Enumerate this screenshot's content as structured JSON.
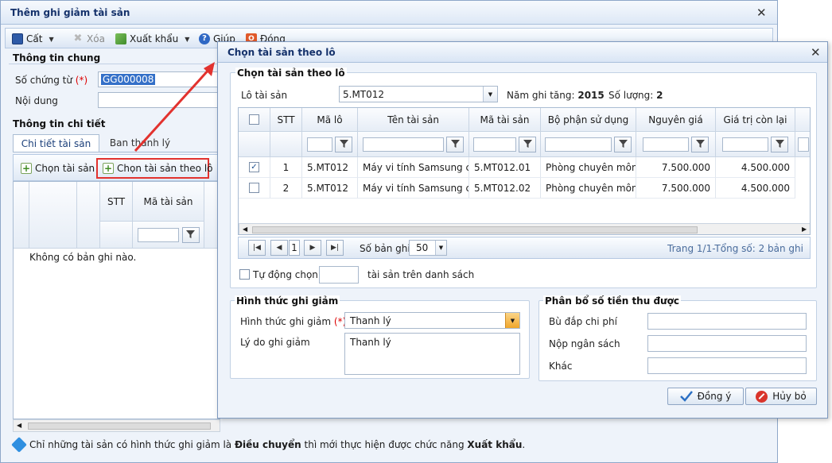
{
  "main": {
    "title": "Thêm ghi giảm tài sản",
    "toolbar": {
      "cut": "Cất",
      "delete": "Xóa",
      "export": "Xuất khẩu",
      "help": "Giúp",
      "close": "Đóng"
    },
    "general": {
      "heading": "Thông tin chung",
      "voucher_label": "Số chứng từ",
      "required_mark": "(*)",
      "voucher_value": "GG000008",
      "content_label": "Nội dung",
      "content_value": ""
    },
    "detail": {
      "heading": "Thông tin chi tiết",
      "tabs": [
        "Chi tiết tài sản",
        "Ban thanh lý"
      ],
      "select_asset_btn": "Chọn tài sản",
      "select_batch_btn": "Chọn tài sản theo lô",
      "col_stt": "STT",
      "col_asset_code": "Mã tài sản",
      "no_records": "Không có bản ghi nào."
    },
    "hint": {
      "prefix": "Chỉ những tài sản có hình thức ghi giảm là ",
      "bold1": "Điều chuyển",
      "middle": " thì mới thực hiện được chức năng ",
      "bold2": "Xuất khẩu",
      "suffix": "."
    }
  },
  "dialog": {
    "title": "Chọn tài sản theo lô",
    "group_heading": "Chọn tài sản theo lô",
    "batch_label": "Lô tài sản",
    "batch_value": "5.MT012",
    "year_label": "Năm ghi tăng:",
    "year_value": "2015",
    "qty_label": "Số lượng:",
    "qty_value": "2",
    "columns": [
      "STT",
      "Mã lô",
      "Tên tài sản",
      "Mã tài sản",
      "Bộ phận sử dụng",
      "Nguyên giá",
      "Giá trị còn lại"
    ],
    "rows": [
      {
        "checked": true,
        "stt": "1",
        "lot": "5.MT012",
        "name": "Máy vi tính Samsung cor",
        "code": "5.MT012.01",
        "dept": "Phòng chuyên môn",
        "cost": "7.500.000",
        "remain": "4.500.000"
      },
      {
        "checked": false,
        "stt": "2",
        "lot": "5.MT012",
        "name": "Máy vi tính Samsung cor",
        "code": "5.MT012.02",
        "dept": "Phòng chuyên môn",
        "cost": "7.500.000",
        "remain": "4.500.000"
      }
    ],
    "pager": {
      "page": "1",
      "records_label": "Số bản ghi:",
      "records_value": "50",
      "summary": "Trang 1/1-Tổng số: 2 bản ghi"
    },
    "auto_select_label": "Tự động chọn",
    "auto_select_suffix": "tài sản trên danh sách",
    "reduction": {
      "heading": "Hình thức ghi giảm",
      "method_label": "Hình thức ghi giảm",
      "required_mark": "(*)",
      "method_value": "Thanh lý",
      "reason_label": "Lý do ghi giảm",
      "reason_value": "Thanh lý"
    },
    "allocation": {
      "heading": "Phân bổ số tiền thu được",
      "items": [
        "Bù đắp chi phí",
        "Nộp ngân sách",
        "Khác"
      ]
    },
    "ok_btn": "Đồng ý",
    "cancel_btn": "Hủy bỏ"
  }
}
